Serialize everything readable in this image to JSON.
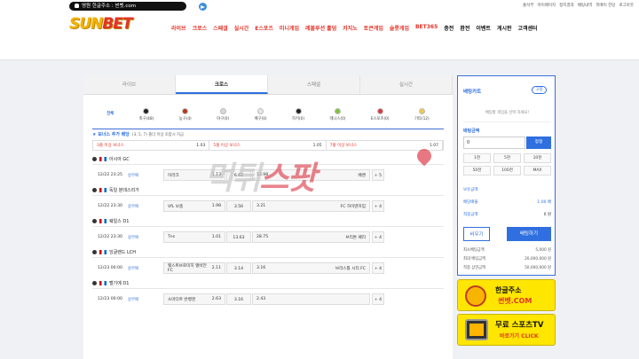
{
  "topbar": {
    "domain_label": "영원 한글주소 : 썬벳.com",
    "links": [
      "출석부",
      "마이페이지",
      "정지결과",
      "배팅내역",
      "쪽메이 전당",
      "로그아웃"
    ]
  },
  "header": {
    "logo_main": "SUN",
    "logo_accent": "BET",
    "nav": [
      {
        "label": "라이브",
        "color": "red"
      },
      {
        "label": "크로스",
        "color": "red"
      },
      {
        "label": "스페셜",
        "color": "red"
      },
      {
        "label": "실시간",
        "color": "red"
      },
      {
        "label": "E스포츠",
        "color": "red"
      },
      {
        "label": "미니게임",
        "color": "red"
      },
      {
        "label": "레볼루션 홀덤",
        "color": "red"
      },
      {
        "label": "카지노",
        "color": "red"
      },
      {
        "label": "토큰게임",
        "color": "red"
      },
      {
        "label": "슬롯게임",
        "color": "red"
      },
      {
        "label": "BET365",
        "color": "red"
      },
      {
        "label": "충전",
        "color": "dark"
      },
      {
        "label": "환전",
        "color": "dark"
      },
      {
        "label": "이벤트",
        "color": "dark"
      },
      {
        "label": "게시판",
        "color": "dark"
      },
      {
        "label": "고객센터",
        "color": "dark"
      }
    ]
  },
  "tabs": [
    "라이브",
    "크로스",
    "스페셜",
    "실시간"
  ],
  "sports": [
    {
      "label": "전체",
      "color": ""
    },
    {
      "label": "축구(48)",
      "color": "#222"
    },
    {
      "label": "농구(4)",
      "color": "#b5371c"
    },
    {
      "label": "야구(0)",
      "color": "#d7d7e0"
    },
    {
      "label": "배구(0)",
      "color": "#e8e8e8"
    },
    {
      "label": "하키(0)",
      "color": "#222"
    },
    {
      "label": "테니스(0)",
      "color": "#7cc43b"
    },
    {
      "label": "E스포츠(0)",
      "color": "#d63a3a"
    },
    {
      "label": "기타(12)",
      "color": "#f1c94a"
    }
  ],
  "bonus": {
    "title": "★ 보너스 추가 배당",
    "subtitle": "(3, 5, 7) 폴더 이상 조합시 지급",
    "items": [
      {
        "label": "3폴 이상 보너스",
        "odd": "1.03"
      },
      {
        "label": "5폴 이상 보너스",
        "odd": "1.05"
      },
      {
        "label": "7폴 이상 보너스",
        "odd": "1.07"
      }
    ]
  },
  "leagues": [
    {
      "name": "아시아 GC",
      "match": {
        "time": "12/22 23:25",
        "type": "승무패",
        "home": "이라크",
        "home_odd": "1.13",
        "draw": "6.62",
        "away": "배맨",
        "away_odd": "13.98",
        "more": "+ 5"
      }
    },
    {
      "name": "독일 분데스리가",
      "match": {
        "time": "12/22 23:30",
        "type": "승무패",
        "home": "VfL 보훔",
        "home_odd": "1.98",
        "draw": "3.56",
        "away": "FC 하이덴하임",
        "away_odd": "3.21",
        "more": "+ 4"
      }
    },
    {
      "name": "웨일스 D1",
      "match": {
        "time": "12/22 23:30",
        "type": "승무패",
        "home": "Tns",
        "home_odd": "1.01",
        "draw": "13.63",
        "away": "브리톤 페리",
        "away_odd": "28.75",
        "more": "+ 4"
      }
    },
    {
      "name": "잉글랜드 LCH",
      "match": {
        "time": "12/23 00:00",
        "type": "승무패",
        "home": "웨스트브로미치 앨비언 FC",
        "home_odd": "2.11",
        "draw": "3.14",
        "away": "브리스톨 시티 FC",
        "away_odd": "3.16",
        "more": "+ 4"
      }
    },
    {
      "name": "벨기에 D1",
      "match": {
        "time": "12/23 00:00",
        "type": "승무패",
        "home": "소마다르 반벵엔",
        "home_odd": "2.63",
        "draw": "3.16",
        "away": "",
        "away_odd": "2.43",
        "more": "+ 4"
      }
    }
  ],
  "cart": {
    "title": "배팅카트",
    "close_label": "고정",
    "empty_msg": "배팅할 게임을 선택 하세요!",
    "amount_label": "배팅금액",
    "amount_value": "0",
    "reset_label": "정정",
    "amounts": [
      "1천",
      "5천",
      "10천",
      "50천",
      "100천",
      "MAX"
    ],
    "info": [
      {
        "k": "보유금액",
        "v": "",
        "blue": false
      },
      {
        "k": "배당배율",
        "v": "1.00 배",
        "blue": true
      },
      {
        "k": "적중금액",
        "v": "0 원",
        "blue": false
      }
    ],
    "btn_clear": "비우기",
    "btn_bet": "배팅하기",
    "limits": [
      {
        "k": "최소배팅금액",
        "v": "5,000 원"
      },
      {
        "k": "최대 배팅금액",
        "v": "20,000,000 원"
      },
      {
        "k": "적중 상한금액",
        "v": "50,000,000 원"
      }
    ]
  },
  "banners": [
    {
      "line1": "한글주소",
      "line2": "썬벳.COM"
    },
    {
      "line1": "무료 스포츠TV",
      "line2": "바로가기 CLICK"
    }
  ],
  "watermark": {
    "part1": "먹튀",
    "part2": "스팟"
  }
}
